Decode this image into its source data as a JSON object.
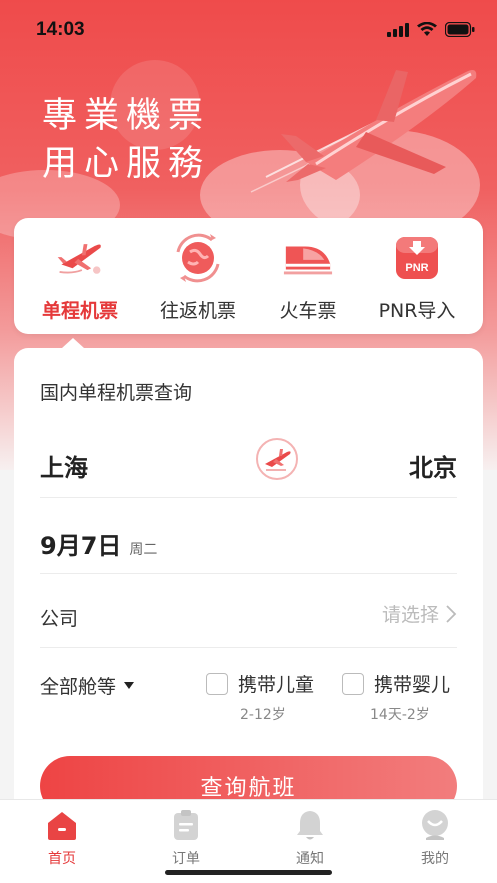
{
  "status": {
    "time": "14:03"
  },
  "hero": {
    "line1": "專業機票",
    "line2": "用心服務"
  },
  "tabs": [
    {
      "label": "单程机票",
      "icon": "plane-oneway-icon"
    },
    {
      "label": "往返机票",
      "icon": "round-trip-icon"
    },
    {
      "label": "火车票",
      "icon": "train-icon"
    },
    {
      "label": "PNR导入",
      "icon": "pnr-icon",
      "badge": "PNR"
    }
  ],
  "form": {
    "title": "国内单程机票查询",
    "from_city": "上海",
    "to_city": "北京",
    "date": "9月7日",
    "weekday": "周二",
    "company_label": "公司",
    "company_placeholder": "请选择",
    "cabin_label": "全部舱等",
    "child_label": "携带儿童",
    "child_sub": "2-12岁",
    "infant_label": "携带婴儿",
    "infant_sub": "14天-2岁",
    "search_button": "查询航班"
  },
  "nav": [
    {
      "label": "首页",
      "icon": "home-icon"
    },
    {
      "label": "订单",
      "icon": "order-icon"
    },
    {
      "label": "通知",
      "icon": "bell-icon"
    },
    {
      "label": "我的",
      "icon": "profile-icon"
    }
  ],
  "colors": {
    "accent": "#e5393a",
    "hero_top": "#ef4b4b"
  }
}
